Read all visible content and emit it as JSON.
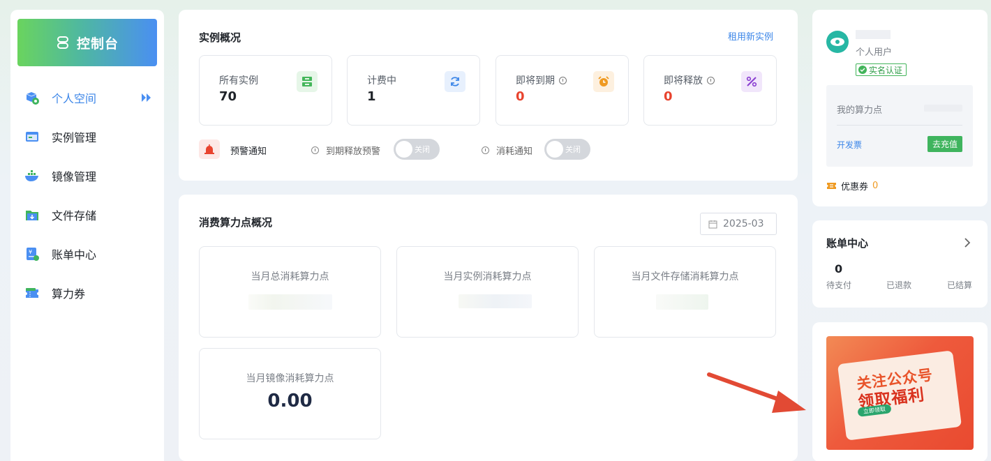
{
  "sidebar": {
    "console_label": "控制台",
    "items": [
      {
        "label": "个人空间",
        "icon": "person-space-icon",
        "active": true
      },
      {
        "label": "实例管理",
        "icon": "instance-icon"
      },
      {
        "label": "镜像管理",
        "icon": "docker-image-icon"
      },
      {
        "label": "文件存储",
        "icon": "folder-storage-icon"
      },
      {
        "label": "账单中心",
        "icon": "bill-icon"
      },
      {
        "label": "算力券",
        "icon": "ticket-icon"
      }
    ]
  },
  "overview": {
    "title": "实例概况",
    "rent_link": "租用新实例",
    "stats": [
      {
        "label": "所有实例",
        "value": "70",
        "icon": "server-icon",
        "color": "#43b65a"
      },
      {
        "label": "计费中",
        "value": "1",
        "icon": "refresh-icon",
        "color": "#3c86e8"
      },
      {
        "label": "即将到期",
        "value": "0",
        "icon": "alarm-clock-icon",
        "color": "#ef9a22"
      },
      {
        "label": "即将释放",
        "value": "0",
        "icon": "release-icon",
        "color": "#8a3fd1"
      }
    ],
    "notice_label": "预警通知",
    "expire_release_label": "到期释放预警",
    "expire_release_toggle": "关闭",
    "consume_label": "消耗通知",
    "consume_toggle": "关闭"
  },
  "consumption": {
    "title": "消费算力点概况",
    "month": "2025-03",
    "boxes": [
      {
        "label": "当月总消耗算力点",
        "value": ""
      },
      {
        "label": "当月实例消耗算力点",
        "value": ""
      },
      {
        "label": "当月文件存储消耗算力点",
        "value": ""
      },
      {
        "label": "当月镜像消耗算力点",
        "value": "0.00"
      }
    ]
  },
  "user": {
    "type": "个人用户",
    "verified_label": "实名认证",
    "points_label": "我的算力点",
    "invoice_link": "开发票",
    "recharge_button": "去充值",
    "coupon_label": "优惠券",
    "coupon_count": "0"
  },
  "bill": {
    "title": "账单中心",
    "items": [
      {
        "label": "待支付",
        "value": "0"
      },
      {
        "label": "已退款",
        "value": ""
      },
      {
        "label": "已结算",
        "value": ""
      }
    ]
  },
  "promo": {
    "line1": "关注公众号",
    "line2": "领取福利",
    "button": "立即领取"
  },
  "colors": {
    "accent": "#3c86e8",
    "danger": "#e8432e",
    "success": "#3fb45e"
  }
}
